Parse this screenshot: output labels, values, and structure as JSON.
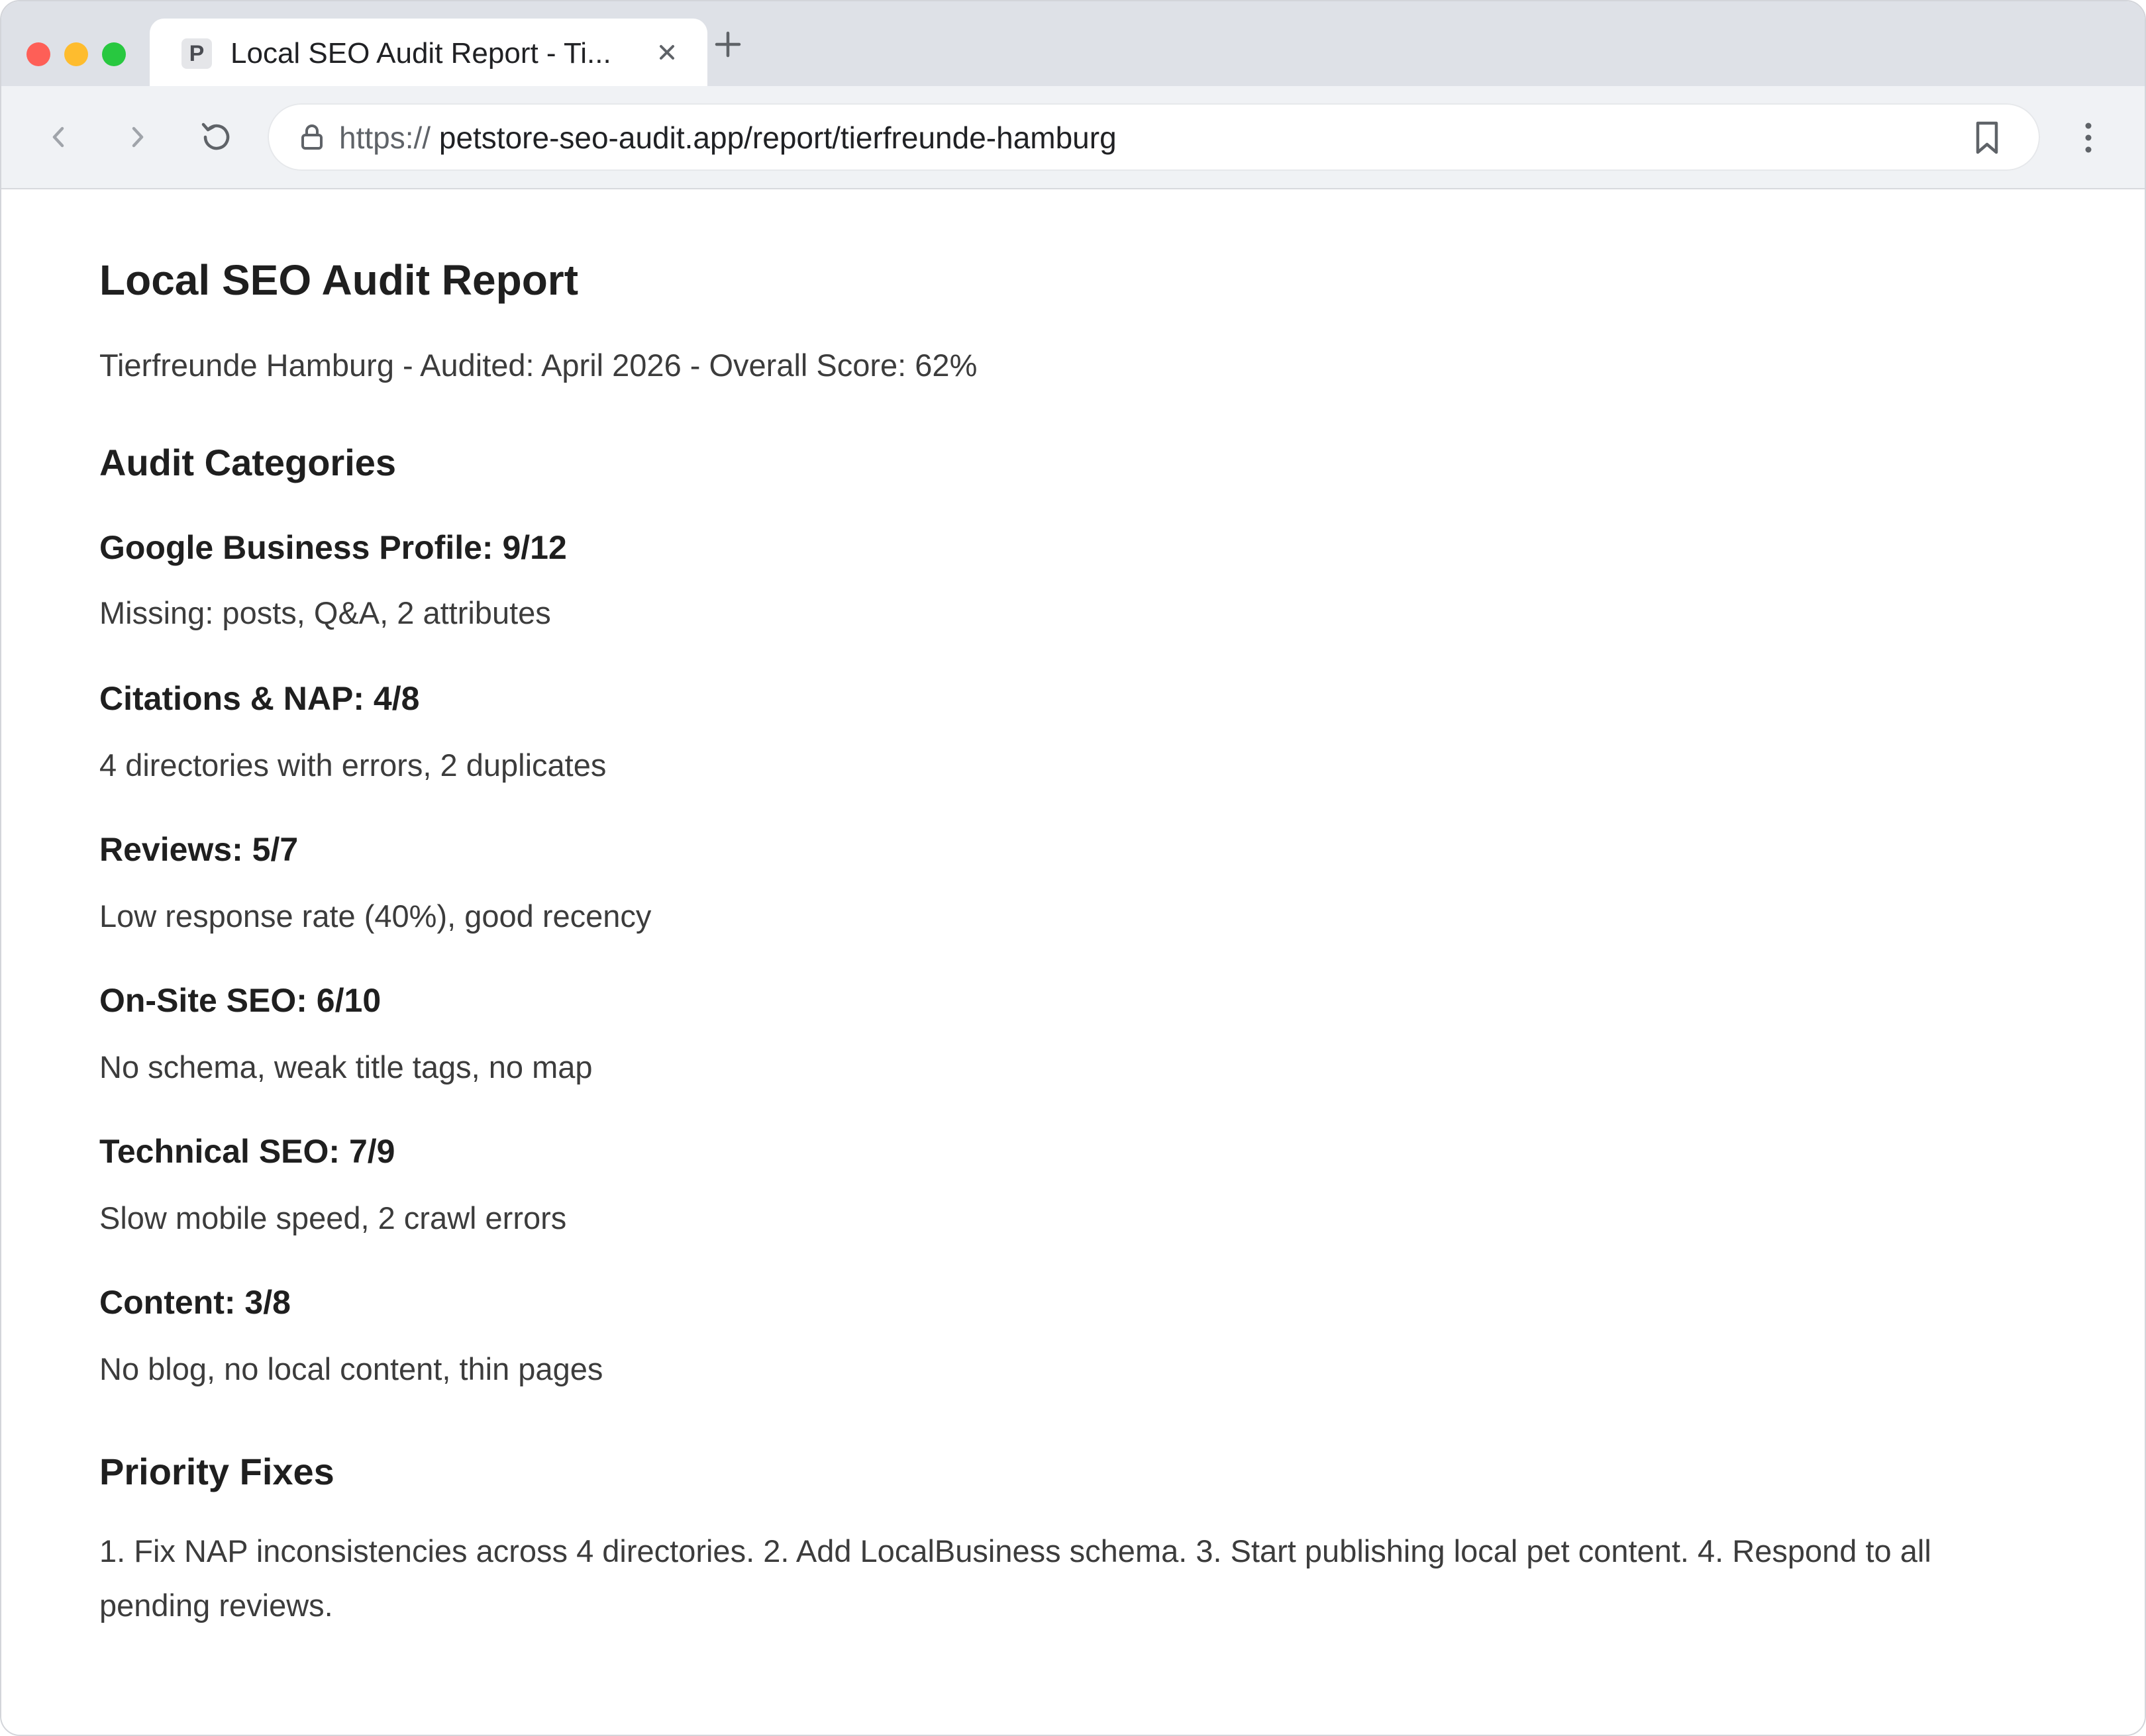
{
  "browser": {
    "tab": {
      "favicon_letter": "P",
      "title": "Local SEO Audit Report - Ti..."
    },
    "new_tab_label": "+",
    "address": {
      "scheme": "https://",
      "host_path": "petstore-seo-audit.app/report/tierfreunde-hamburg"
    },
    "icons": {
      "back": "chevron-left-icon",
      "forward": "chevron-right-icon",
      "reload": "reload-icon",
      "lock": "lock-icon",
      "bookmark": "bookmark-icon",
      "menu": "kebab-menu-icon",
      "close": "close-icon"
    }
  },
  "report": {
    "title": "Local SEO Audit Report",
    "meta": "Tierfreunde Hamburg - Audited: April 2026 - Overall Score: 62%",
    "categories_heading": "Audit Categories",
    "categories": [
      {
        "title": "Google Business Profile: 9/12",
        "desc": "Missing: posts, Q&A, 2 attributes"
      },
      {
        "title": "Citations & NAP: 4/8",
        "desc": "4 directories with errors, 2 duplicates"
      },
      {
        "title": "Reviews: 5/7",
        "desc": "Low response rate (40%), good recency"
      },
      {
        "title": "On-Site SEO: 6/10",
        "desc": "No schema, weak title tags, no map"
      },
      {
        "title": "Technical SEO: 7/9",
        "desc": "Slow mobile speed, 2 crawl errors"
      },
      {
        "title": "Content: 3/8",
        "desc": "No blog, no local content, thin pages"
      }
    ],
    "fixes_heading": "Priority Fixes",
    "fixes_text": "1. Fix NAP inconsistencies across 4 directories. 2. Add LocalBusiness schema. 3. Start publishing local pet content. 4. Respond to all pending reviews."
  },
  "colors": {
    "tabbar": "#dee1e7",
    "toolbar": "#f0f2f5",
    "close_red": "#fe5f57",
    "minimize_yellow": "#febc2e",
    "zoom_green": "#28c840"
  }
}
